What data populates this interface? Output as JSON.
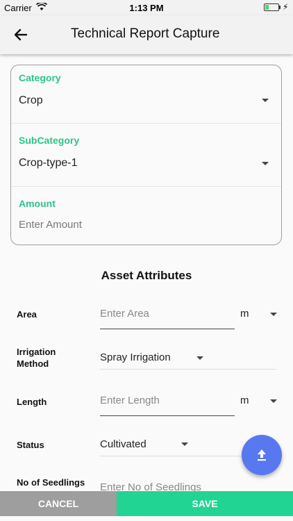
{
  "status_bar": {
    "carrier": "Carrier",
    "time": "1:13 PM",
    "battery_level": 0.3
  },
  "app_bar": {
    "title": "Technical Report Capture"
  },
  "form": {
    "category": {
      "label": "Category",
      "value": "Crop"
    },
    "subcategory": {
      "label": "SubCategory",
      "value": "Crop-type-1"
    },
    "amount": {
      "label": "Amount",
      "placeholder": "Enter Amount"
    }
  },
  "asset_attributes": {
    "title": "Asset Attributes",
    "rows": [
      {
        "label": "Area",
        "placeholder": "Enter Area",
        "unit": "m"
      },
      {
        "label": "Irrigation Method",
        "value": "Spray Irrigation"
      },
      {
        "label": "Length",
        "placeholder": "Enter Length",
        "unit": "m"
      },
      {
        "label": "Status",
        "value": "Cultivated"
      },
      {
        "label": "No of Seedlings",
        "placeholder": "Enter No of Seedlings"
      }
    ]
  },
  "actions": {
    "cancel_label": "CANCEL",
    "save_label": "SAVE"
  },
  "colors": {
    "accent_green": "#2bc48a",
    "save_green": "#22d494",
    "cancel_gray": "#9e9e9e",
    "fab_blue": "#5878f0"
  },
  "icons": {
    "back": "arrow-left-icon",
    "upload": "upload-icon",
    "dropdown": "caret-down-icon"
  }
}
